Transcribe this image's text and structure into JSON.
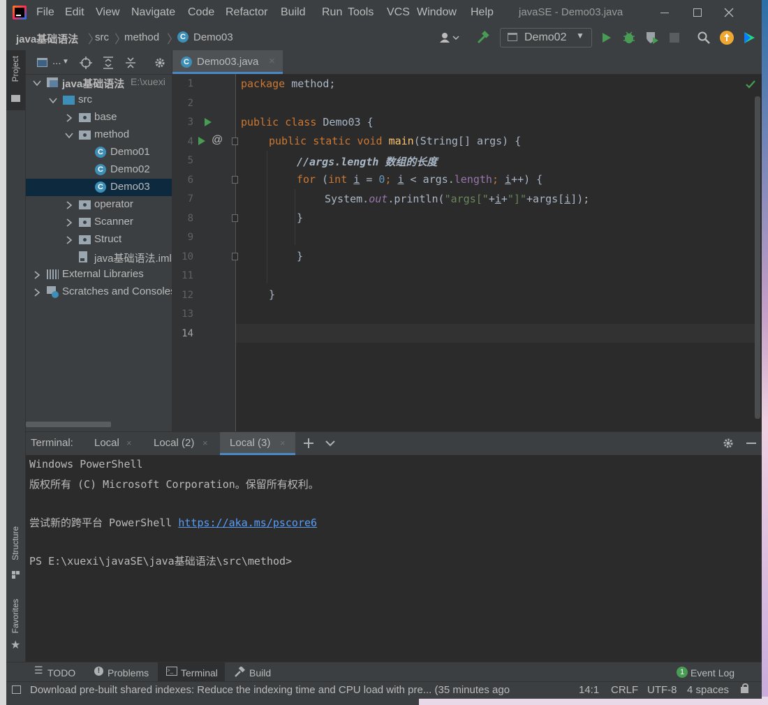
{
  "window": {
    "title": "javaSE - Demo03.java",
    "menu": [
      "File",
      "Edit",
      "View",
      "Navigate",
      "Code",
      "Refactor",
      "Build",
      "Run",
      "Tools",
      "VCS",
      "Window",
      "Help"
    ]
  },
  "breadcrumb": [
    "java基础语法",
    "src",
    "method",
    "Demo03"
  ],
  "run_config": "Demo02",
  "side_tools": {
    "project": "Project",
    "structure": "Structure",
    "favorites": "Favorites"
  },
  "project_toolbar": {
    "view_label": "..."
  },
  "project_tree": [
    {
      "label": "java基础语法",
      "extra": "E:\\xuexi",
      "indent": 0,
      "arrow": "down",
      "icon": "module",
      "bold": true
    },
    {
      "label": "src",
      "indent": 1,
      "arrow": "down",
      "icon": "folder-blue"
    },
    {
      "label": "base",
      "indent": 2,
      "arrow": "right",
      "icon": "package"
    },
    {
      "label": "method",
      "indent": 2,
      "arrow": "down",
      "icon": "package"
    },
    {
      "label": "Demo01",
      "indent": 3,
      "arrow": "",
      "icon": "class"
    },
    {
      "label": "Demo02",
      "indent": 3,
      "arrow": "",
      "icon": "class"
    },
    {
      "label": "Demo03",
      "indent": 3,
      "arrow": "",
      "icon": "class",
      "selected": true
    },
    {
      "label": "operator",
      "indent": 2,
      "arrow": "right",
      "icon": "package"
    },
    {
      "label": "Scanner",
      "indent": 2,
      "arrow": "right",
      "icon": "package"
    },
    {
      "label": "Struct",
      "indent": 2,
      "arrow": "right",
      "icon": "package"
    },
    {
      "label": "java基础语法.iml",
      "indent": 2,
      "arrow": "",
      "icon": "file"
    },
    {
      "label": "External Libraries",
      "indent": 0,
      "arrow": "right",
      "icon": "library"
    },
    {
      "label": "Scratches and Consoles",
      "indent": 0,
      "arrow": "right",
      "icon": "scratch"
    }
  ],
  "editor_tab": "Demo03.java",
  "line_numbers": [
    "1",
    "2",
    "3",
    "4",
    "5",
    "6",
    "7",
    "8",
    "9",
    "10",
    "11",
    "12",
    "13",
    "14"
  ],
  "code": {
    "l1_kw": "package",
    "l1_rest": " method;",
    "l3_kw": "public class",
    "l3_rest": " Demo03 {",
    "l4_kw": "public static void",
    "l4_fn": "main",
    "l4_rest": "(String[] args) {",
    "l5_comment": "//args.length 数组的长度",
    "l6_for": "for",
    "l6_p1": " (",
    "l6_int": "int",
    "l6_i1": "i",
    "l6_eq": " = ",
    "l6_zero": "0",
    "l6_semi1": "; ",
    "l6_i2": "i",
    "l6_lt": " < args.",
    "l6_len": "length",
    "l6_semi2": "; ",
    "l6_i3": "i",
    "l6_end": "++) {",
    "l7_sys": "System.",
    "l7_out": "out",
    "l7_println": ".println(",
    "l7_s1": "\"args[\"",
    "l7_plus1": "+",
    "l7_i": "i",
    "l7_plus2": "+",
    "l7_s2": "\"]\"",
    "l7_plus3": "+args[",
    "l7_i2": "i",
    "l7_end": "]);",
    "l8": "}",
    "l10": "}",
    "l12": "}"
  },
  "terminal": {
    "label": "Terminal:",
    "tabs": [
      "Local",
      "Local (2)",
      "Local (3)"
    ],
    "active_tab": "Local (3)",
    "lines": {
      "l1": "Windows PowerShell",
      "l2": "版权所有 (C) Microsoft Corporation。保留所有权利。",
      "l4_prefix": "尝试新的跨平台 PowerShell ",
      "l4_link": "https://aka.ms/pscore6",
      "l6": "PS E:\\xuexi\\javaSE\\java基础语法\\src\\method>"
    }
  },
  "bottom_tools": {
    "todo": "TODO",
    "problems": "Problems",
    "terminal": "Terminal",
    "build": "Build",
    "event_log": "Event Log",
    "event_count": "1"
  },
  "status": {
    "message": "Download pre-built shared indexes: Reduce the indexing time and CPU load with pre... (35 minutes ago",
    "position": "14:1",
    "line_sep": "CRLF",
    "encoding": "UTF-8",
    "indent": "4 spaces"
  },
  "colors": {
    "accent": "#4a88c7",
    "run": "#499c54",
    "bg_editor": "#2b2b2b",
    "bg_panel": "#3c3f41"
  }
}
